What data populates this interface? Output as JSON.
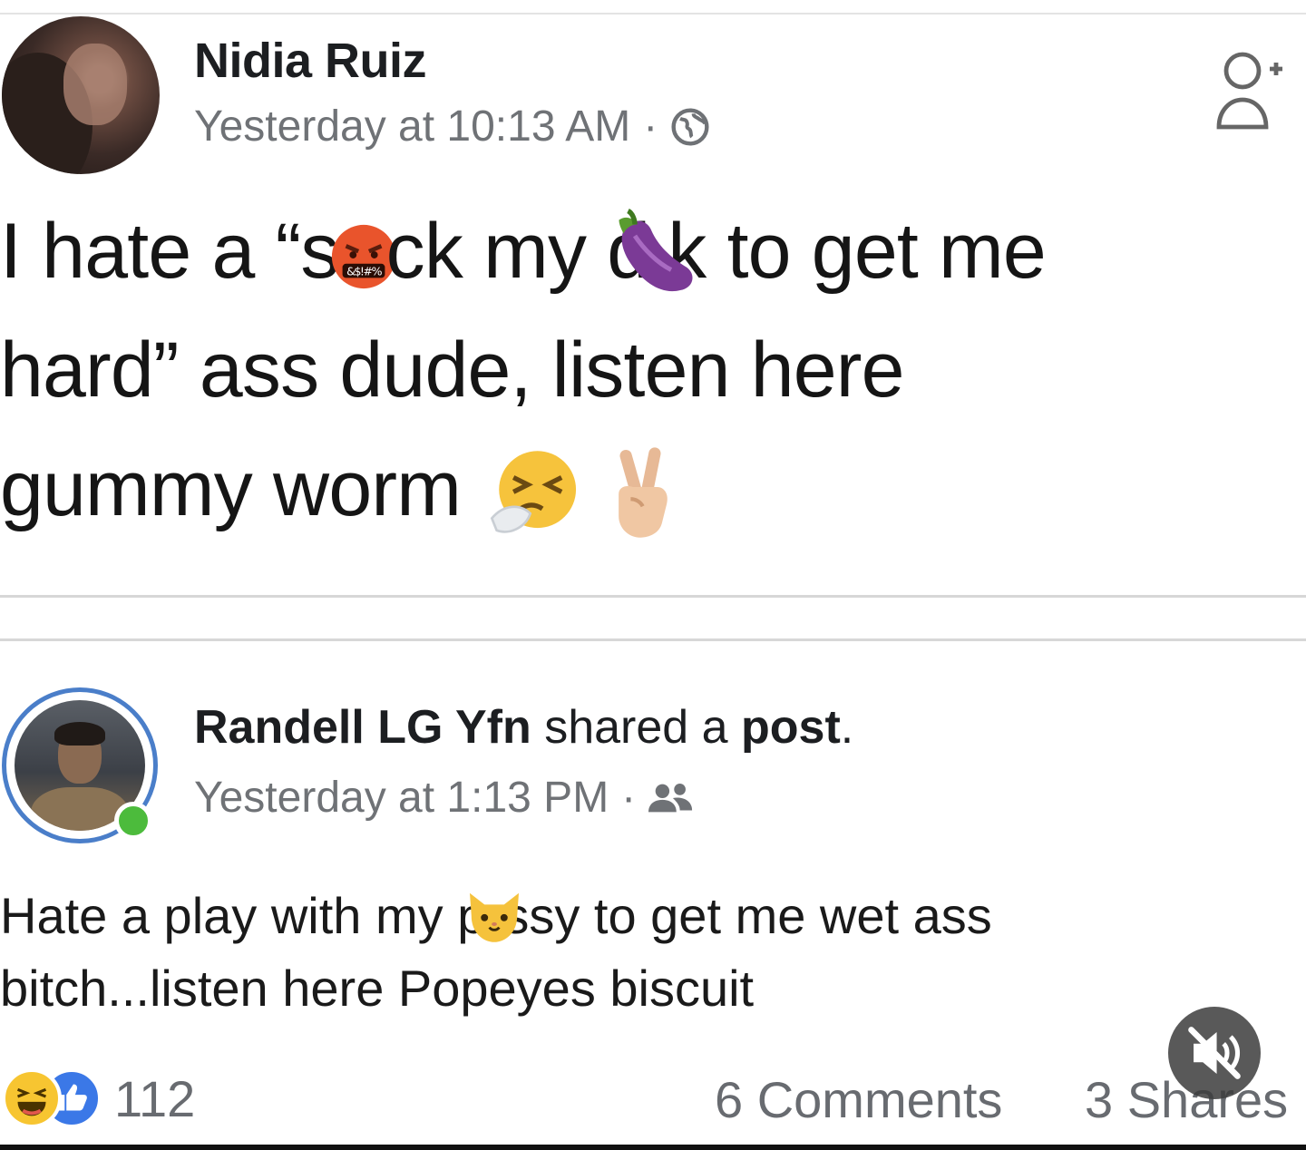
{
  "post1": {
    "author": "Nidia Ruiz",
    "timestamp": "Yesterday at 10:13 AM",
    "separator": "·",
    "privacy_icon": "globe-icon",
    "action_icon": "add-friend-icon",
    "text": {
      "l1a": "I hate a “s",
      "l1b": "ck my d",
      "l1c": "k to get me",
      "l2": "hard” ass dude, listen here",
      "l3": "gummy worm"
    },
    "emojis": [
      "cursing-face-icon",
      "eggplant-icon",
      "sneezing-face-icon",
      "victory-hand-icon"
    ]
  },
  "post2": {
    "author": "Randell LG Yfn",
    "action_mid": " shared a ",
    "action_obj": "post",
    "action_end": ".",
    "timestamp": "Yesterday at 1:13 PM",
    "separator": "·",
    "privacy_icon": "friends-icon",
    "online": true,
    "text": {
      "l1a": "Hate a play with my p",
      "l1b": "ssy to get me wet ass",
      "l2": "bitch...listen here Popeyes biscuit"
    },
    "emojis": [
      "cat-face-icon"
    ]
  },
  "footer": {
    "reactions": [
      "haha-icon",
      "like-icon"
    ],
    "reaction_count": "112",
    "comments": "6 Comments",
    "shares": "3 Shares"
  },
  "overlay": {
    "mute_icon": "muted-speaker-icon"
  },
  "colors": {
    "meta_text": "#6f7276",
    "link_blue": "#4a7ec9",
    "online_green": "#4cbb3c",
    "like_blue": "#3b78e7",
    "haha_yellow": "#f7c531"
  }
}
